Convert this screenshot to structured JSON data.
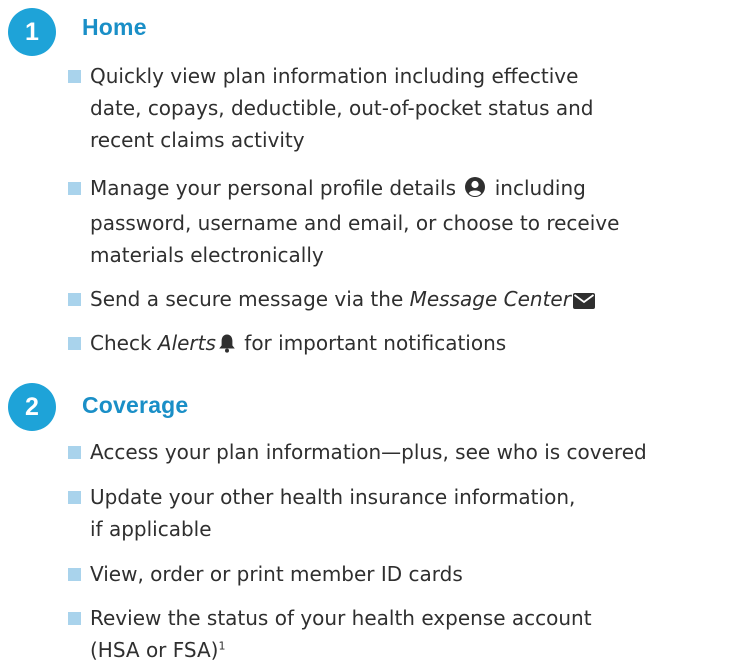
{
  "sections": [
    {
      "number": "1",
      "title": "Home",
      "items": [
        {
          "lines": [
            "Quickly view plan information including effective",
            "date, copays, deductible, out-of-pocket status and",
            "recent claims activity"
          ]
        },
        {
          "line1_before_icon": "Manage your personal profile details ",
          "line1_after_icon": " including",
          "lines_rest": [
            "password, username and email, or choose to receive",
            "materials electronically"
          ],
          "icon": "user-profile-icon"
        },
        {
          "before": "Send a secure message via the ",
          "italic": "Message Center",
          "icon": "envelope-icon"
        },
        {
          "before": "Check ",
          "italic": "Alerts",
          "after": " for important notifications",
          "icon": "bell-icon"
        }
      ]
    },
    {
      "number": "2",
      "title": "Coverage",
      "items": [
        {
          "lines": [
            "Access your plan information—plus, see who is covered"
          ]
        },
        {
          "lines": [
            "Update your other health insurance information,",
            "if applicable"
          ]
        },
        {
          "lines": [
            "View, order or print member ID cards"
          ]
        },
        {
          "line1": "Review the status of your health expense account",
          "line2": "(HSA or FSA)",
          "footnote": "1"
        }
      ]
    }
  ],
  "colors": {
    "badge": "#1ea3d8",
    "heading": "#1a8fc7",
    "bullet": "#a9d3ec",
    "text": "#2f2f2f"
  }
}
